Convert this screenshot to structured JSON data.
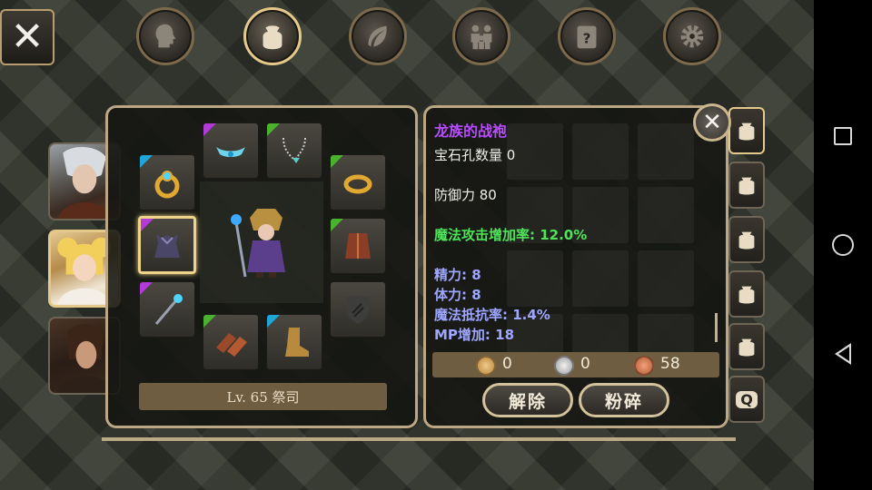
{
  "tabs": [
    {
      "icon": "head-icon"
    },
    {
      "icon": "bag-icon",
      "active": true
    },
    {
      "icon": "leaf-icon"
    },
    {
      "icon": "family-icon"
    },
    {
      "icon": "scroll-icon"
    },
    {
      "icon": "gear-icon"
    }
  ],
  "equipment": {
    "level_label": "Lv. 65 祭司"
  },
  "item": {
    "name": "龙族的战袍",
    "socket_line": "宝石孔数量 0",
    "defense_line": "防御力 80",
    "magic_attack_line": "魔法攻击增加率: 12.0%",
    "stats": [
      "精力: 8",
      "体力: 8",
      "魔法抵抗率: 1.4%",
      "MP增加: 18"
    ],
    "colors": {
      "name": "#b84cff",
      "magic_attack": "#4fe35a",
      "stats": "#9ea6ff"
    }
  },
  "currency": {
    "gold": "0",
    "silver": "0",
    "copper": "58"
  },
  "actions": {
    "unequip_label": "解除",
    "smash_label": "粉碎"
  },
  "bag_tabs": {
    "last_label": "Q"
  }
}
